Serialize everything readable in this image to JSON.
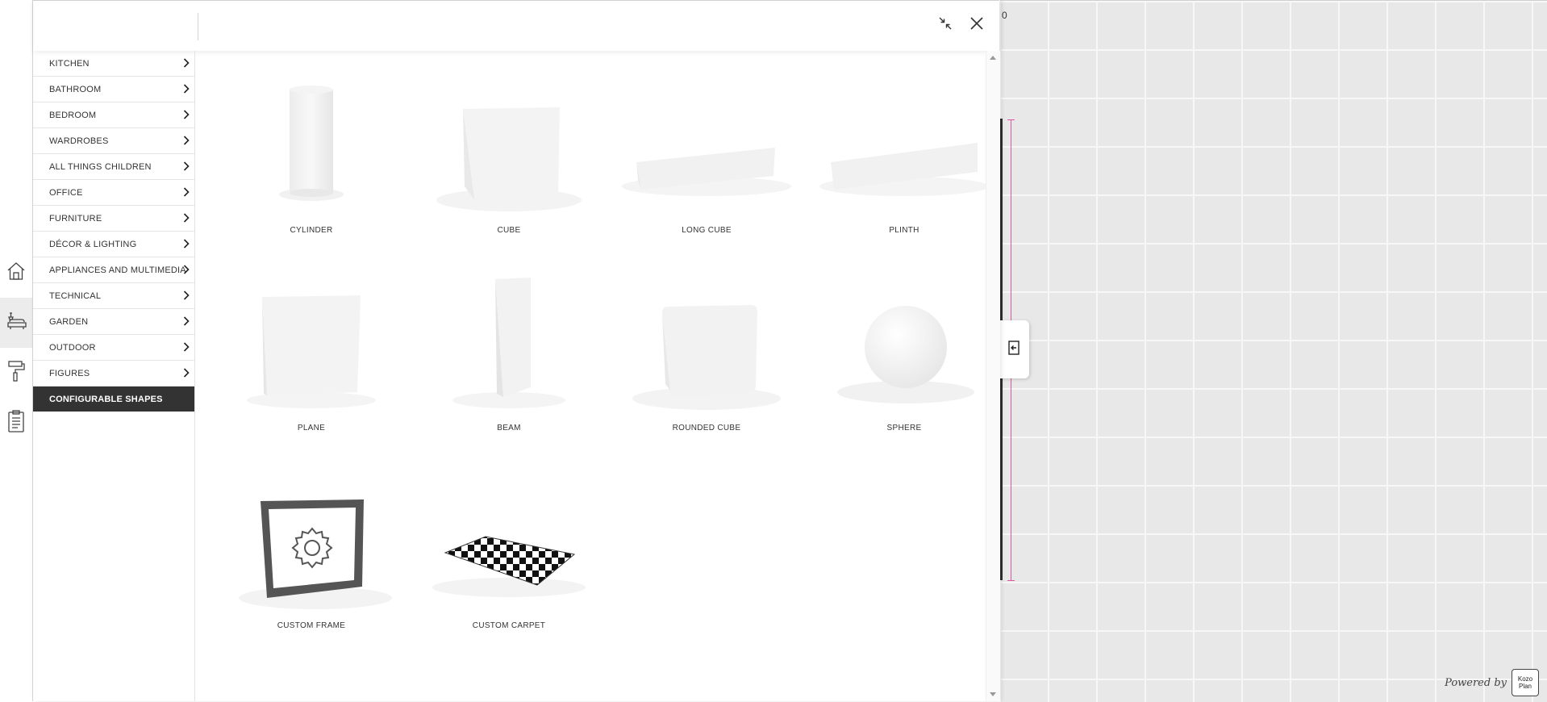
{
  "canvas": {
    "tab_text": "0",
    "toggle_icon": "panel-toggle-icon"
  },
  "branding": {
    "powered_text": "Powered by",
    "logo_text": "Kozo Plan"
  },
  "iconbar": [
    {
      "name": "home-icon",
      "active": false
    },
    {
      "name": "sofa-icon",
      "active": true
    },
    {
      "name": "paint-roller-icon",
      "active": false
    },
    {
      "name": "clipboard-icon",
      "active": false
    }
  ],
  "header": {
    "search_placeholder": "",
    "minimize_icon": "minimize-icon",
    "close_icon": "close-icon"
  },
  "categories": [
    {
      "label": "KITCHEN",
      "has_children": true
    },
    {
      "label": "BATHROOM",
      "has_children": true
    },
    {
      "label": "BEDROOM",
      "has_children": true
    },
    {
      "label": "WARDROBES",
      "has_children": true
    },
    {
      "label": "ALL THINGS CHILDREN",
      "has_children": true
    },
    {
      "label": "OFFICE",
      "has_children": true
    },
    {
      "label": "FURNITURE",
      "has_children": true
    },
    {
      "label": "DÉCOR & LIGHTING",
      "has_children": true
    },
    {
      "label": "APPLIANCES AND MULTIMEDIA",
      "has_children": true
    },
    {
      "label": "TECHNICAL",
      "has_children": true
    },
    {
      "label": "GARDEN",
      "has_children": true
    },
    {
      "label": "OUTDOOR",
      "has_children": true
    },
    {
      "label": "FIGURES",
      "has_children": true
    },
    {
      "label": "CONFIGURABLE SHAPES",
      "has_children": false,
      "active": true
    }
  ],
  "shapes": [
    {
      "label": "CYLINDER",
      "icon": "cylinder"
    },
    {
      "label": "CUBE",
      "icon": "cube"
    },
    {
      "label": "LONG CUBE",
      "icon": "long-cube"
    },
    {
      "label": "PLINTH",
      "icon": "plinth"
    },
    {
      "label": "PLANE",
      "icon": "plane"
    },
    {
      "label": "BEAM",
      "icon": "beam"
    },
    {
      "label": "ROUNDED CUBE",
      "icon": "rounded-cube"
    },
    {
      "label": "SPHERE",
      "icon": "sphere"
    },
    {
      "label": "CUSTOM FRAME",
      "icon": "custom-frame"
    },
    {
      "label": "CUSTOM CARPET",
      "icon": "custom-carpet"
    }
  ],
  "colors": {
    "active_category_bg": "#333333",
    "measure_line": "#e0559f",
    "canvas_bg": "#e8e8e8"
  }
}
